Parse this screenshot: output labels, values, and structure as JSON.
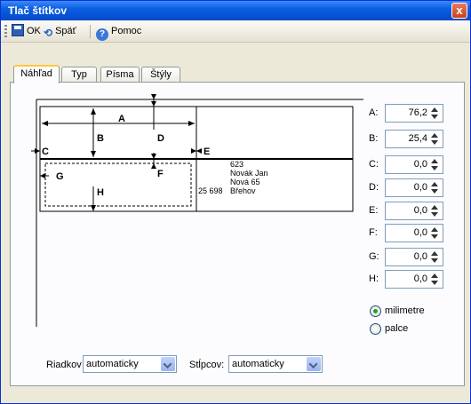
{
  "window": {
    "title": "Tlač štítkov",
    "close": "x"
  },
  "toolbar": {
    "ok": "OK",
    "back": "Späť",
    "help": "Pomoc"
  },
  "tabs": [
    "Náhľad",
    "Typ",
    "Písma",
    "Štýly"
  ],
  "preview": {
    "dims": [
      "A",
      "B",
      "C",
      "D",
      "E",
      "F",
      "G",
      "H"
    ],
    "label_lines": [
      "623",
      "Novák Jan",
      "Nová 65",
      "Břehov"
    ],
    "postal": "25 698"
  },
  "fields": [
    {
      "label": "A:",
      "value": "76,2"
    },
    {
      "label": "B:",
      "value": "25,4"
    },
    {
      "label": "C:",
      "value": "0,0"
    },
    {
      "label": "D:",
      "value": "0,0"
    },
    {
      "label": "E:",
      "value": "0,0"
    },
    {
      "label": "F:",
      "value": "0,0"
    },
    {
      "label": "G:",
      "value": "0,0"
    },
    {
      "label": "H:",
      "value": "0,0"
    }
  ],
  "units": {
    "mm": "milimetre",
    "inch": "palce",
    "selected": "milimetre"
  },
  "rows": {
    "label": "Riadkov",
    "value": "automaticky"
  },
  "cols": {
    "label": "Stĺpcov:",
    "value": "automaticky"
  }
}
